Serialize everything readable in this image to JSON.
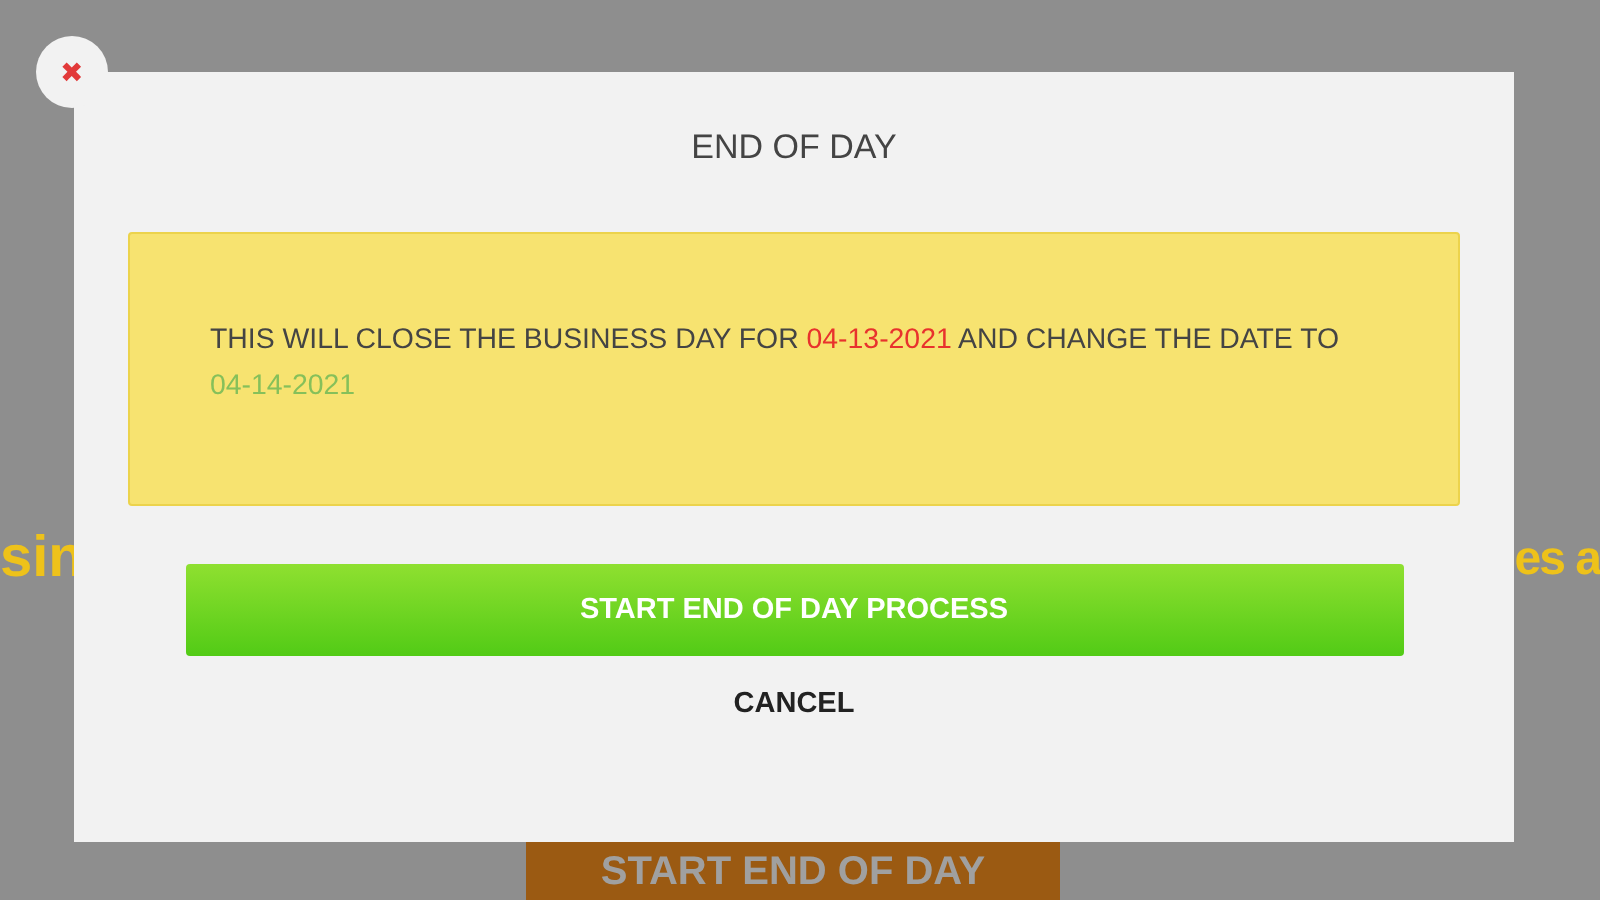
{
  "background": {
    "text_left": "sin",
    "text_right": "es a",
    "button": "START END OF DAY"
  },
  "dialog": {
    "close": "✖",
    "title": "END OF DAY",
    "message": [
      {
        "text": "THIS WILL CLOSE THE BUSINESS DAY FOR ",
        "color": "#444444"
      },
      {
        "text": "04-13-2021",
        "color": "#e8322d"
      },
      {
        "text": " AND CHANGE THE DATE TO ",
        "color": "#444444"
      },
      {
        "text": "04-14-2021",
        "color": "#86c05a"
      }
    ],
    "primary_button": "START END OF DAY PROCESS",
    "cancel_button": "CANCEL"
  }
}
